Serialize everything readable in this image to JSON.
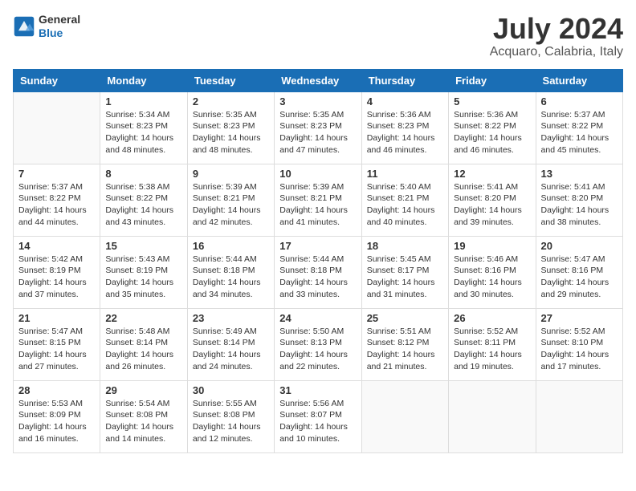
{
  "logo": {
    "line1": "General",
    "line2": "Blue"
  },
  "title": "July 2024",
  "location": "Acquaro, Calabria, Italy",
  "headers": [
    "Sunday",
    "Monday",
    "Tuesday",
    "Wednesday",
    "Thursday",
    "Friday",
    "Saturday"
  ],
  "weeks": [
    [
      {
        "day": "",
        "info": ""
      },
      {
        "day": "1",
        "info": "Sunrise: 5:34 AM\nSunset: 8:23 PM\nDaylight: 14 hours\nand 48 minutes."
      },
      {
        "day": "2",
        "info": "Sunrise: 5:35 AM\nSunset: 8:23 PM\nDaylight: 14 hours\nand 48 minutes."
      },
      {
        "day": "3",
        "info": "Sunrise: 5:35 AM\nSunset: 8:23 PM\nDaylight: 14 hours\nand 47 minutes."
      },
      {
        "day": "4",
        "info": "Sunrise: 5:36 AM\nSunset: 8:23 PM\nDaylight: 14 hours\nand 46 minutes."
      },
      {
        "day": "5",
        "info": "Sunrise: 5:36 AM\nSunset: 8:22 PM\nDaylight: 14 hours\nand 46 minutes."
      },
      {
        "day": "6",
        "info": "Sunrise: 5:37 AM\nSunset: 8:22 PM\nDaylight: 14 hours\nand 45 minutes."
      }
    ],
    [
      {
        "day": "7",
        "info": "Sunrise: 5:37 AM\nSunset: 8:22 PM\nDaylight: 14 hours\nand 44 minutes."
      },
      {
        "day": "8",
        "info": "Sunrise: 5:38 AM\nSunset: 8:22 PM\nDaylight: 14 hours\nand 43 minutes."
      },
      {
        "day": "9",
        "info": "Sunrise: 5:39 AM\nSunset: 8:21 PM\nDaylight: 14 hours\nand 42 minutes."
      },
      {
        "day": "10",
        "info": "Sunrise: 5:39 AM\nSunset: 8:21 PM\nDaylight: 14 hours\nand 41 minutes."
      },
      {
        "day": "11",
        "info": "Sunrise: 5:40 AM\nSunset: 8:21 PM\nDaylight: 14 hours\nand 40 minutes."
      },
      {
        "day": "12",
        "info": "Sunrise: 5:41 AM\nSunset: 8:20 PM\nDaylight: 14 hours\nand 39 minutes."
      },
      {
        "day": "13",
        "info": "Sunrise: 5:41 AM\nSunset: 8:20 PM\nDaylight: 14 hours\nand 38 minutes."
      }
    ],
    [
      {
        "day": "14",
        "info": "Sunrise: 5:42 AM\nSunset: 8:19 PM\nDaylight: 14 hours\nand 37 minutes."
      },
      {
        "day": "15",
        "info": "Sunrise: 5:43 AM\nSunset: 8:19 PM\nDaylight: 14 hours\nand 35 minutes."
      },
      {
        "day": "16",
        "info": "Sunrise: 5:44 AM\nSunset: 8:18 PM\nDaylight: 14 hours\nand 34 minutes."
      },
      {
        "day": "17",
        "info": "Sunrise: 5:44 AM\nSunset: 8:18 PM\nDaylight: 14 hours\nand 33 minutes."
      },
      {
        "day": "18",
        "info": "Sunrise: 5:45 AM\nSunset: 8:17 PM\nDaylight: 14 hours\nand 31 minutes."
      },
      {
        "day": "19",
        "info": "Sunrise: 5:46 AM\nSunset: 8:16 PM\nDaylight: 14 hours\nand 30 minutes."
      },
      {
        "day": "20",
        "info": "Sunrise: 5:47 AM\nSunset: 8:16 PM\nDaylight: 14 hours\nand 29 minutes."
      }
    ],
    [
      {
        "day": "21",
        "info": "Sunrise: 5:47 AM\nSunset: 8:15 PM\nDaylight: 14 hours\nand 27 minutes."
      },
      {
        "day": "22",
        "info": "Sunrise: 5:48 AM\nSunset: 8:14 PM\nDaylight: 14 hours\nand 26 minutes."
      },
      {
        "day": "23",
        "info": "Sunrise: 5:49 AM\nSunset: 8:14 PM\nDaylight: 14 hours\nand 24 minutes."
      },
      {
        "day": "24",
        "info": "Sunrise: 5:50 AM\nSunset: 8:13 PM\nDaylight: 14 hours\nand 22 minutes."
      },
      {
        "day": "25",
        "info": "Sunrise: 5:51 AM\nSunset: 8:12 PM\nDaylight: 14 hours\nand 21 minutes."
      },
      {
        "day": "26",
        "info": "Sunrise: 5:52 AM\nSunset: 8:11 PM\nDaylight: 14 hours\nand 19 minutes."
      },
      {
        "day": "27",
        "info": "Sunrise: 5:52 AM\nSunset: 8:10 PM\nDaylight: 14 hours\nand 17 minutes."
      }
    ],
    [
      {
        "day": "28",
        "info": "Sunrise: 5:53 AM\nSunset: 8:09 PM\nDaylight: 14 hours\nand 16 minutes."
      },
      {
        "day": "29",
        "info": "Sunrise: 5:54 AM\nSunset: 8:08 PM\nDaylight: 14 hours\nand 14 minutes."
      },
      {
        "day": "30",
        "info": "Sunrise: 5:55 AM\nSunset: 8:08 PM\nDaylight: 14 hours\nand 12 minutes."
      },
      {
        "day": "31",
        "info": "Sunrise: 5:56 AM\nSunset: 8:07 PM\nDaylight: 14 hours\nand 10 minutes."
      },
      {
        "day": "",
        "info": ""
      },
      {
        "day": "",
        "info": ""
      },
      {
        "day": "",
        "info": ""
      }
    ]
  ]
}
